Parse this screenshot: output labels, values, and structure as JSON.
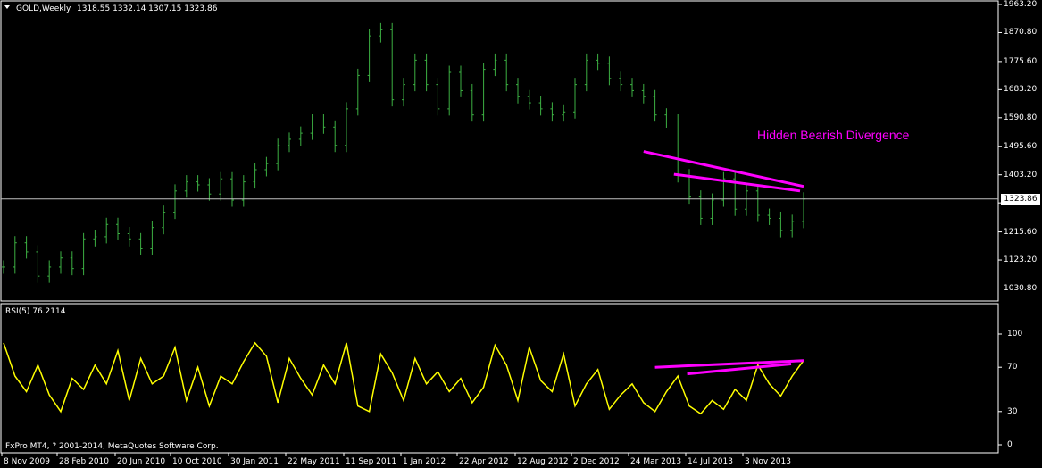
{
  "window": {
    "symbol_label": "GOLD,Weekly",
    "ohlc_label": "1318.55 1332.14 1307.15 1323.86",
    "current_price_label": "1323.86",
    "indicator_label": "RSI(5) 76.2114",
    "copyright": "FxPro MT4, ? 2001-2014, MetaQuotes Software Corp.",
    "annotation": "Hidden Bearish Divergence",
    "menu_icon": "dropdown-triangle-icon"
  },
  "colors": {
    "background": "#000000",
    "frame": "#ffffff",
    "grid": "#000000",
    "price_bars": "#3cb043",
    "rsi_line": "#ffff00",
    "divergence": "#ff00ff",
    "price_line": "#c0c0c0"
  },
  "chart_data": [
    {
      "type": "ohlc",
      "title": "GOLD,Weekly",
      "ylim": [
        1000,
        1963.2
      ],
      "y_ticks": [
        "1963.20",
        "1870.80",
        "1775.60",
        "1683.20",
        "1590.80",
        "1495.60",
        "1403.20",
        "1323.86",
        "1215.60",
        "1123.20",
        "1030.80"
      ],
      "y_tick_values": [
        1963.2,
        1870.8,
        1775.6,
        1683.2,
        1590.8,
        1495.6,
        1403.2,
        1310.8,
        1215.6,
        1123.2,
        1030.8
      ],
      "current_price": 1323.86,
      "x_ticks": [
        "8 Nov 2009",
        "28 Feb 2010",
        "20 Jun 2010",
        "10 Oct 2010",
        "30 Jan 2011",
        "22 May 2011",
        "11 Sep 2011",
        "1 Jan 2012",
        "22 Apr 2012",
        "12 Aug 2012",
        "2 Dec 2012",
        "24 Mar 2013",
        "14 Jul 2013",
        "3 Nov 2013"
      ],
      "approx_closes": [
        1100,
        1180,
        1150,
        1070,
        1100,
        1130,
        1095,
        1190,
        1200,
        1240,
        1210,
        1190,
        1160,
        1230,
        1280,
        1350,
        1380,
        1370,
        1340,
        1390,
        1320,
        1380,
        1420,
        1440,
        1500,
        1520,
        1540,
        1580,
        1560,
        1500,
        1620,
        1730,
        1860,
        1880,
        1650,
        1700,
        1780,
        1700,
        1620,
        1740,
        1680,
        1600,
        1750,
        1780,
        1700,
        1660,
        1640,
        1620,
        1600,
        1610,
        1700,
        1780,
        1770,
        1720,
        1700,
        1680,
        1660,
        1600,
        1580,
        1400,
        1330,
        1260,
        1320,
        1390,
        1290,
        1350,
        1270,
        1260,
        1220,
        1250,
        1323.86
      ],
      "divergence_line_price": {
        "from": 1480,
        "to": 1365
      }
    },
    {
      "type": "line",
      "title": "RSI(5) 76.2114",
      "ylim": [
        0,
        100
      ],
      "y_ticks": [
        "100",
        "70",
        "30",
        "0"
      ],
      "y_tick_values": [
        100,
        70,
        30,
        0
      ],
      "current_value": 76.2114,
      "approx_values": [
        92,
        62,
        48,
        72,
        45,
        30,
        60,
        50,
        72,
        55,
        85,
        40,
        78,
        55,
        62,
        88,
        40,
        70,
        35,
        62,
        55,
        75,
        92,
        80,
        38,
        78,
        60,
        45,
        72,
        55,
        92,
        35,
        30,
        82,
        65,
        40,
        78,
        55,
        66,
        48,
        60,
        38,
        52,
        90,
        72,
        40,
        88,
        58,
        48,
        82,
        35,
        55,
        68,
        32,
        45,
        55,
        38,
        30,
        48,
        62,
        35,
        28,
        40,
        32,
        50,
        40,
        72,
        55,
        44,
        62,
        76.21
      ],
      "divergence_line_rsi": {
        "from": 70,
        "to": 76
      }
    }
  ]
}
